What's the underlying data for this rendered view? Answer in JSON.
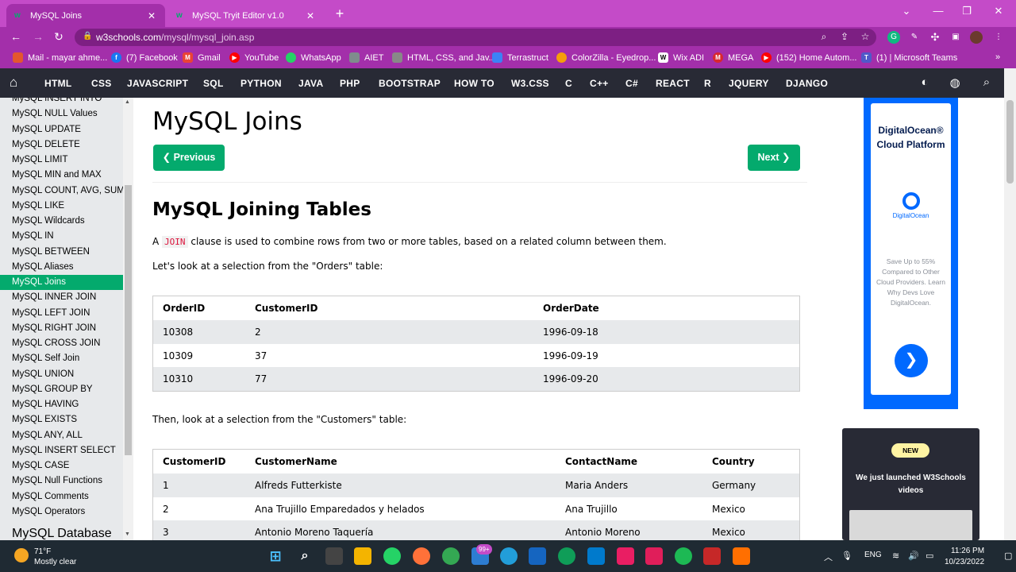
{
  "browser": {
    "tabs": [
      {
        "title": "MySQL Joins",
        "active": true
      },
      {
        "title": "MySQL Tryit Editor v1.0",
        "active": false
      }
    ],
    "url_host": "w3schools.com",
    "url_path": "/mysql/mysql_join.asp",
    "bookmarks": [
      "Mail - mayar ahme...",
      "(7) Facebook",
      "Gmail",
      "YouTube",
      "WhatsApp",
      "AIET",
      "HTML, CSS, and Jav...",
      "Terrastruct",
      "ColorZilla - Eyedrop...",
      "Wix ADI",
      "MEGA",
      "(152) Home Autom...",
      "(1) | Microsoft Teams"
    ]
  },
  "topnav": [
    "HTML",
    "CSS",
    "JAVASCRIPT",
    "SQL",
    "PYTHON",
    "JAVA",
    "PHP",
    "BOOTSTRAP",
    "HOW TO",
    "W3.CSS",
    "C",
    "C++",
    "C#",
    "REACT",
    "R",
    "JQUERY",
    "DJANGO"
  ],
  "sidebar": {
    "items": [
      "MySQL INSERT INTO",
      "MySQL NULL Values",
      "MySQL UPDATE",
      "MySQL DELETE",
      "MySQL LIMIT",
      "MySQL MIN and MAX",
      "MySQL COUNT, AVG, SUM",
      "MySQL LIKE",
      "MySQL Wildcards",
      "MySQL IN",
      "MySQL BETWEEN",
      "MySQL Aliases",
      "MySQL Joins",
      "MySQL INNER JOIN",
      "MySQL LEFT JOIN",
      "MySQL RIGHT JOIN",
      "MySQL CROSS JOIN",
      "MySQL Self Join",
      "MySQL UNION",
      "MySQL GROUP BY",
      "MySQL HAVING",
      "MySQL EXISTS",
      "MySQL ANY, ALL",
      "MySQL INSERT SELECT",
      "MySQL CASE",
      "MySQL Null Functions",
      "MySQL Comments",
      "MySQL Operators"
    ],
    "active_index": 12,
    "heading": "MySQL Database"
  },
  "main": {
    "title": "MySQL Joins",
    "prev_label": "❮ Previous",
    "next_label": "Next ❯",
    "section_title": "MySQL Joining Tables",
    "intro_pre": "A ",
    "intro_code": "JOIN",
    "intro_post": " clause is used to combine rows from two or more tables, based on a related column between them.",
    "orders_intro": "Let's look at a selection from the \"Orders\" table:",
    "orders_table": {
      "headers": [
        "OrderID",
        "CustomerID",
        "OrderDate"
      ],
      "rows": [
        [
          "10308",
          "2",
          "1996-09-18"
        ],
        [
          "10309",
          "37",
          "1996-09-19"
        ],
        [
          "10310",
          "77",
          "1996-09-20"
        ]
      ]
    },
    "customers_intro": "Then, look at a selection from the \"Customers\" table:",
    "customers_table": {
      "headers": [
        "CustomerID",
        "CustomerName",
        "ContactName",
        "Country"
      ],
      "rows": [
        [
          "1",
          "Alfreds Futterkiste",
          "Maria Anders",
          "Germany"
        ],
        [
          "2",
          "Ana Trujillo Emparedados y helados",
          "Ana Trujillo",
          "Mexico"
        ],
        [
          "3",
          "Antonio Moreno Taquería",
          "Antonio Moreno",
          "Mexico"
        ]
      ]
    }
  },
  "ads": {
    "do_title": "DigitalOcean® Cloud Platform",
    "do_logo_text": "DigitalOcean",
    "do_body": "Save Up to 55% Compared to Other Cloud Providers. Learn Why Devs Love DigitalOcean.",
    "new_badge": "NEW",
    "videos_text": "We just launched W3Schools videos"
  },
  "taskbar": {
    "temp": "71°F",
    "weather": "Mostly clear",
    "badge": "99+",
    "lang": "ENG",
    "time": "11:26 PM",
    "date": "10/23/2022"
  },
  "colors": {
    "accent": "#04aa6d",
    "nav": "#282a35",
    "chrome": "#a32faa"
  }
}
